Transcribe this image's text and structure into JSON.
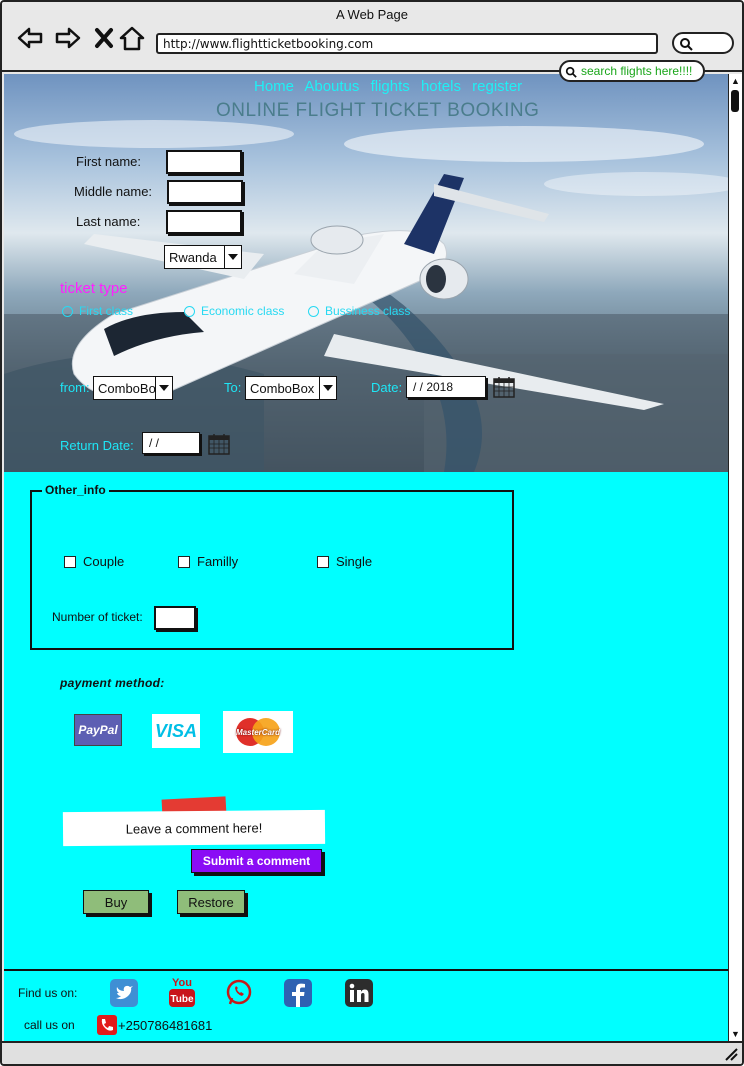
{
  "window": {
    "title": "A Web Page",
    "url": "http://www.flightticketbooking.com"
  },
  "nav": {
    "links": [
      "Home",
      "Aboutus",
      "flights",
      "hotels",
      "register"
    ],
    "search_text": "search flights here!!!!"
  },
  "hero": {
    "title": "ONLINE FLIGHT TICKET BOOKING",
    "first_name_label": "First name:",
    "middle_name_label": "Middle name:",
    "last_name_label": "Last name:",
    "country_value": "Rwanda",
    "ticket_type_label": "ticket type",
    "ticket_options": [
      "First class",
      "Economic class",
      "Bussiness class"
    ],
    "from_label": "from:",
    "from_value": "ComboBox",
    "to_label": "To:",
    "to_value": "ComboBox",
    "date_label": "Date:",
    "date_value": "/  /  2018",
    "return_label": "Return Date:",
    "return_value": "/  /"
  },
  "other_info": {
    "legend": "Other_info",
    "options": [
      "Couple",
      "Familly",
      "Single"
    ],
    "tickets_label": "Number of ticket:"
  },
  "payment": {
    "label": "payment method:",
    "methods": [
      "PayPal",
      "VISA",
      "MasterCard"
    ]
  },
  "comment": {
    "placeholder": "Leave a comment here!",
    "submit_label": "Submit a comment"
  },
  "actions": {
    "buy_label": "Buy",
    "restore_label": "Restore"
  },
  "footer": {
    "find_label": "Find us on:",
    "call_label": "call us on",
    "phone": "+250786481681",
    "social": [
      "twitter-icon",
      "youtube-icon",
      "whatsapp-icon",
      "facebook-icon",
      "linkedin-icon"
    ]
  },
  "colors": {
    "main_bg": "#00ffff",
    "nav_link": "#1ff0f5",
    "ticket_type": "#ff1fff",
    "submit_bg": "#8a0cf5",
    "green_btn": "#8fbd7a"
  }
}
